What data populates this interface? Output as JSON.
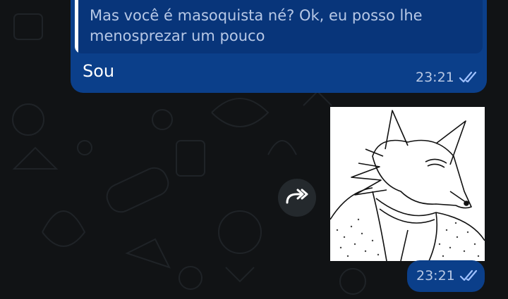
{
  "chat": {
    "messages": [
      {
        "quote_text": "Mas você é masoquista né? Ok, eu posso lhe menosprezar um pouco",
        "text": "Sou",
        "time": "23:21",
        "status_icon": "double-check-read-icon"
      },
      {
        "media_icon": "wolf-illustration",
        "time": "23:21",
        "status_icon": "double-check-read-icon",
        "forward_icon": "forward-icon"
      }
    ]
  },
  "colors": {
    "background": "#111315",
    "outgoing_bubble": "#0b3f8a",
    "quote_bubble": "#08357a",
    "read_ticks": "#9fc1ff"
  }
}
